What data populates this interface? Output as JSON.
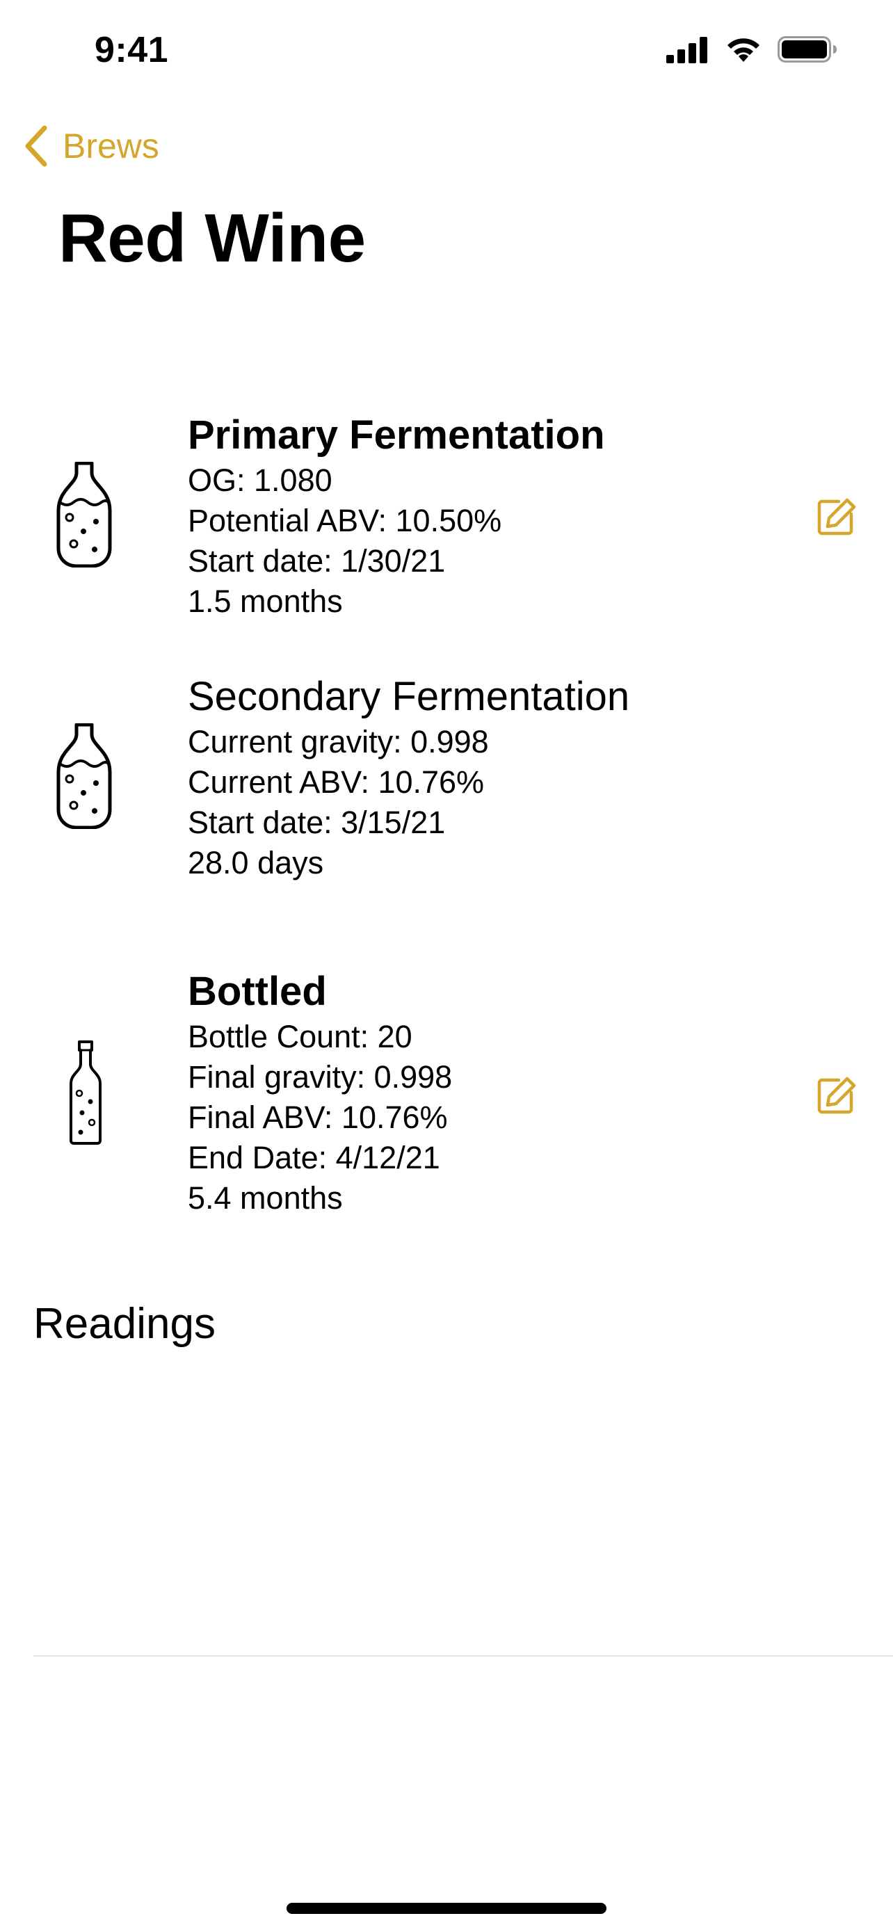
{
  "colors": {
    "accent": "#D4A72C",
    "text": "#000000",
    "divider": "#E3E3E6"
  },
  "status_bar": {
    "time": "9:41",
    "icons": [
      "cellular-signal-icon",
      "wifi-icon",
      "battery-icon"
    ]
  },
  "nav": {
    "back_label": "Brews",
    "back_icon": "chevron-left-icon",
    "title": "Red Wine"
  },
  "stages": [
    {
      "title": "Primary Fermentation",
      "icon": "carboy-icon",
      "lines": [
        "OG: 1.080",
        "Potential ABV: 10.50%",
        "Start date: 1/30/21",
        "1.5 months"
      ],
      "editable": true
    },
    {
      "title": "Secondary Fermentation",
      "icon": "carboy-icon",
      "lines": [
        "Current gravity: 0.998",
        "Current ABV: 10.76%",
        "Start date: 3/15/21",
        "28.0 days"
      ],
      "editable": false
    },
    {
      "title": "Bottled",
      "icon": "wine-bottle-icon",
      "lines": [
        "Bottle Count: 20",
        "Final gravity: 0.998",
        "Final ABV: 10.76%",
        "End Date: 4/12/21",
        "5.4 months"
      ],
      "editable": true
    }
  ],
  "readings": {
    "title": "Readings"
  }
}
